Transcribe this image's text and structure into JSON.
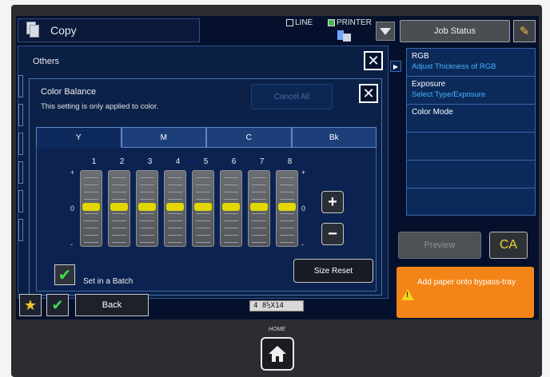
{
  "header": {
    "title": "Copy",
    "mode_line": "LINE",
    "mode_printer": "PRINTER",
    "job_status": "Job Status"
  },
  "others": {
    "title": "Others"
  },
  "color_balance": {
    "title": "Color Balance",
    "subtitle": "This setting is only applied to color.",
    "cancel_all": "Cancel All",
    "tabs": [
      "Y",
      "M",
      "C",
      "Bk"
    ],
    "active_tab": "Y",
    "slider_numbers": [
      "1",
      "2",
      "3",
      "4",
      "5",
      "6",
      "7",
      "8"
    ],
    "slider_values": [
      0,
      0,
      0,
      0,
      0,
      0,
      0,
      0
    ],
    "scale_plus": "+",
    "scale_zero": "0",
    "scale_minus": "-",
    "plus_label": "+",
    "minus_label": "−",
    "batch_label": "Set in a Batch",
    "size_reset": "Size Reset"
  },
  "bottom": {
    "back": "Back",
    "paper_indicator": "4 8½X14"
  },
  "right_panel": {
    "items": [
      {
        "title": "RGB",
        "sub": "Adjust Thickness of RGB"
      },
      {
        "title": "Exposure",
        "sub": "Select Type/Exposure"
      },
      {
        "title": "Color Mode",
        "sub": ""
      },
      {
        "title": "",
        "sub": ""
      },
      {
        "title": "",
        "sub": ""
      },
      {
        "title": "",
        "sub": ""
      }
    ],
    "preview": "Preview",
    "ca": "CA",
    "alert": "Add paper onto bypass-tray"
  },
  "home": {
    "label": "HOME"
  },
  "colors": {
    "screen_bg": "#05112c",
    "panel_bg": "#0b2148",
    "accent_blue": "#49b4ff",
    "alert_orange": "#f28418",
    "knob_yellow": "#e2d800"
  }
}
